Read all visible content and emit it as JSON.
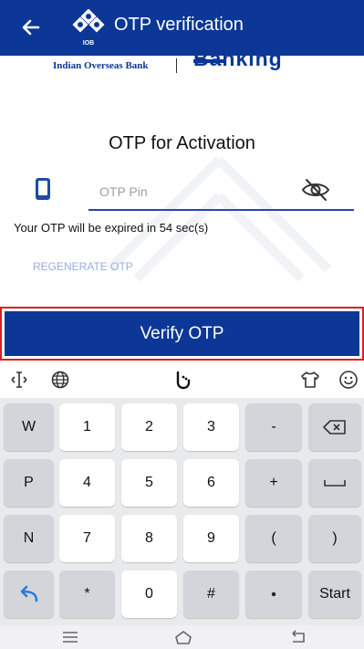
{
  "app": {
    "title": "OTP verification",
    "logo_text": "IOB"
  },
  "banner": {
    "bank_name": "Indian Overseas Bank",
    "banking": "Banking"
  },
  "form": {
    "heading": "OTP for Activation",
    "otp_placeholder": "OTP Pin",
    "otp_value": "",
    "expiry_text": "Your OTP will be expired in 54 sec(s)",
    "regenerate_label": "REGENERATE OTP",
    "verify_label": "Verify OTP"
  },
  "keyboard": {
    "toolbar_icons": [
      "cursor-move-icon",
      "globe-icon",
      "handwriting-icon",
      "theme-shirt-icon",
      "emoji-icon"
    ],
    "rows": [
      [
        "W",
        "1",
        "2",
        "3",
        "-",
        "backspace"
      ],
      [
        "P",
        "4",
        "5",
        "6",
        "+",
        "space"
      ],
      [
        "N",
        "7",
        "8",
        "9",
        "(",
        ")"
      ],
      [
        "back",
        "*",
        "0",
        "#",
        ".",
        "Start"
      ]
    ],
    "keys": {
      "w": "W",
      "p": "P",
      "n": "N",
      "k1": "1",
      "k2": "2",
      "k3": "3",
      "k4": "4",
      "k5": "5",
      "k6": "6",
      "k7": "7",
      "k8": "8",
      "k9": "9",
      "k0": "0",
      "minus": "-",
      "plus": "+",
      "lparen": "(",
      "rparen": ")",
      "star": "*",
      "hash": "#",
      "start": "Start"
    }
  },
  "navbar": {
    "icons": [
      "menu-icon",
      "home-icon",
      "back-icon"
    ]
  },
  "colors": {
    "primary": "#0c3796",
    "highlight_border": "#e01b22",
    "regenerate_link": "#9aaedb",
    "keyboard_bg": "#e9eaec",
    "key_dark": "#d3d5da",
    "back_key_icon": "#2a7bd6"
  }
}
